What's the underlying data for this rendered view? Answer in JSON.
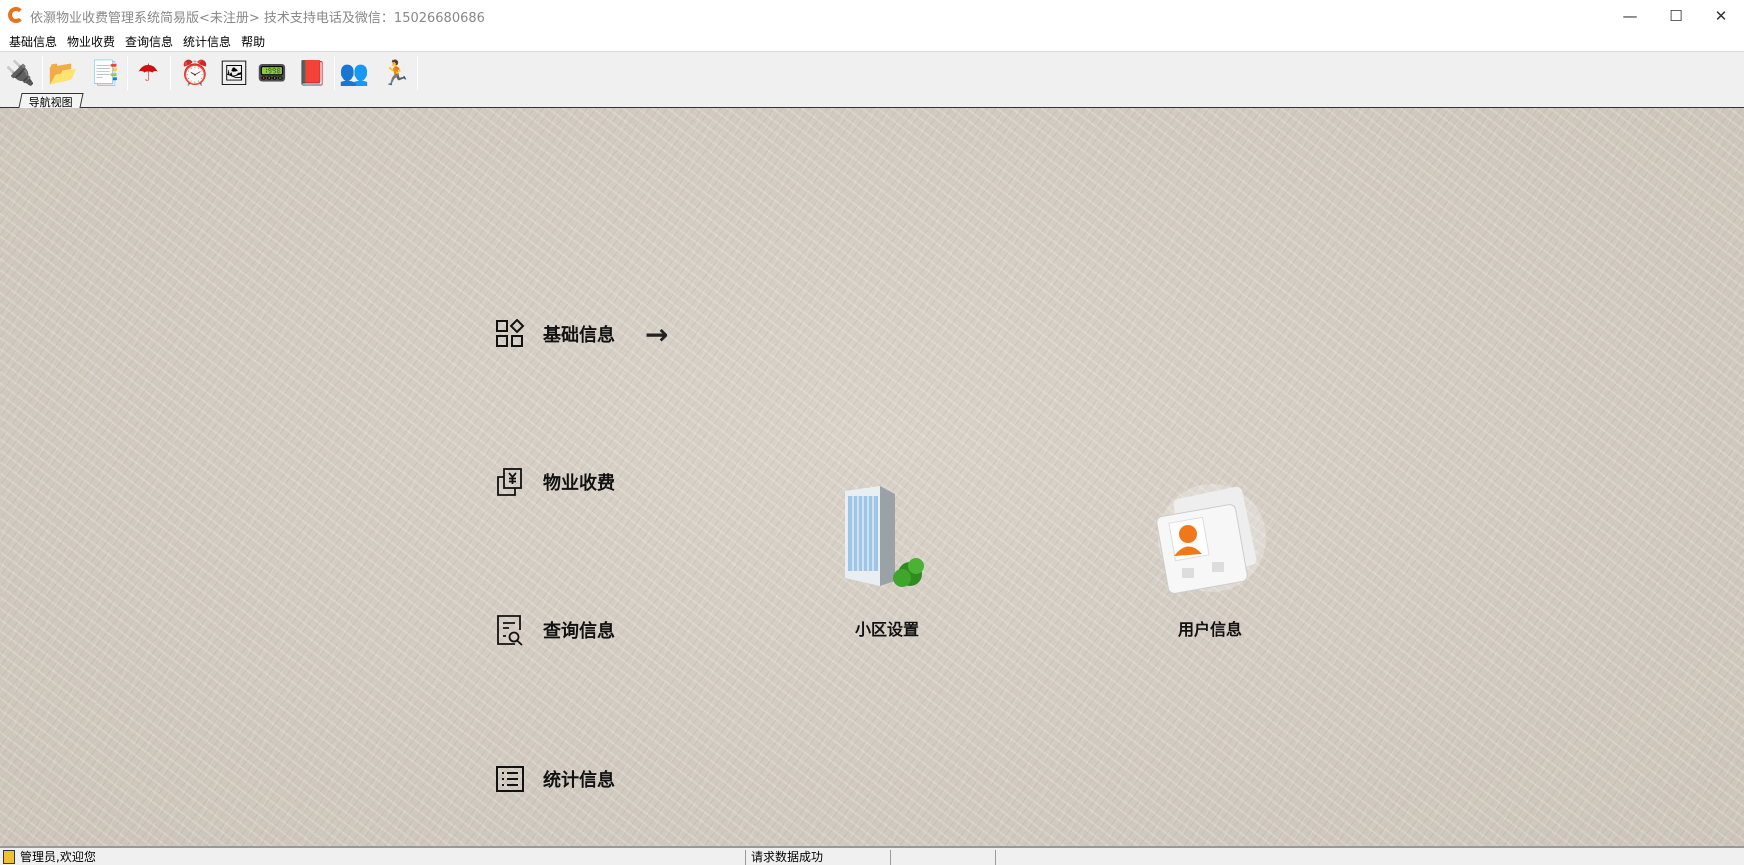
{
  "window": {
    "title": "依灏物业收费管理系统简易版<未注册> 技术支持电话及微信：15026680686",
    "minimize": "—",
    "maximize": "☐",
    "close": "✕"
  },
  "menu": [
    "基础信息",
    "物业收费",
    "查询信息",
    "统计信息",
    "帮助"
  ],
  "toolbar": [
    {
      "icon": "connect-icon",
      "glyph": "🔌"
    },
    {
      "icon": "folder-icon",
      "glyph": "📂"
    },
    {
      "icon": "copy-files-icon",
      "glyph": "📑"
    },
    {
      "icon": "umbrella-icon",
      "glyph": "☂"
    },
    {
      "icon": "alarm-clock-icon",
      "glyph": "⏰"
    },
    {
      "icon": "picture-icon",
      "glyph": "🖼"
    },
    {
      "icon": "pda-icon",
      "glyph": "📟"
    },
    {
      "icon": "help-book-icon",
      "glyph": "📕"
    },
    {
      "icon": "users-icon",
      "glyph": "👥"
    },
    {
      "icon": "running-man-icon",
      "glyph": "🏃"
    }
  ],
  "tab": "导航视图",
  "nav": [
    "基础信息",
    "物业收费",
    "查询信息",
    "统计信息"
  ],
  "arrow": "→",
  "modules": [
    {
      "label": "小区设置"
    },
    {
      "label": "用户信息"
    }
  ],
  "status": {
    "user": "管理员,欢迎您",
    "message": "请求数据成功"
  }
}
